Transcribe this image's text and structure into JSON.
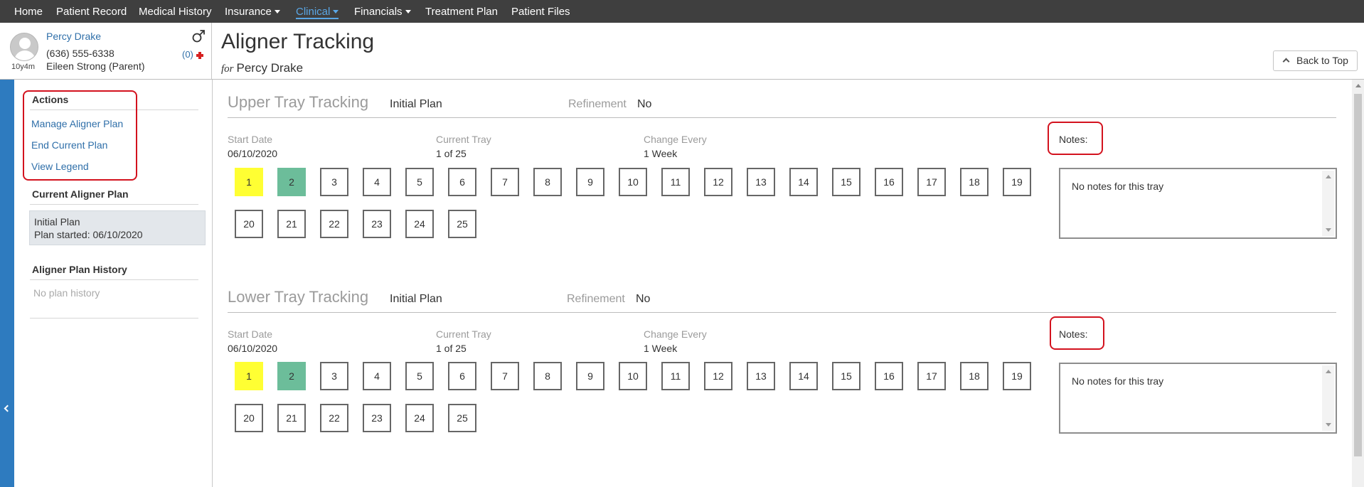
{
  "nav": {
    "items": [
      {
        "label": "Home"
      },
      {
        "label": "Patient Record"
      },
      {
        "label": "Medical History"
      },
      {
        "label": "Insurance"
      },
      {
        "label": "Clinical"
      },
      {
        "label": "Financials"
      },
      {
        "label": "Treatment Plan"
      },
      {
        "label": "Patient Files"
      }
    ],
    "active": "Clinical",
    "active_color": "#5aa7e6"
  },
  "patient": {
    "name": "Percy Drake",
    "phone": "(636) 555-6338",
    "parent": "Eileen Strong (Parent)",
    "age": "10y4m",
    "alerts": "(0)"
  },
  "page": {
    "title": "Aligner Tracking",
    "for_prefix": "for",
    "for_name": "Percy Drake",
    "back_to_top": "Back to Top"
  },
  "sidebar": {
    "actions_title": "Actions",
    "actions": [
      {
        "label": "Manage Aligner Plan"
      },
      {
        "label": "End Current Plan"
      },
      {
        "label": "View Legend"
      }
    ],
    "current_plan_title": "Current Aligner Plan",
    "current_plan_name": "Initial Plan",
    "current_plan_started": "Plan started: 06/10/2020",
    "history_title": "Aligner Plan History",
    "history_empty": "No plan history"
  },
  "upper": {
    "title": "Upper Tray Tracking",
    "plan": "Initial Plan",
    "refinement_label": "Refinement",
    "refinement_value": "No",
    "start_label": "Start Date",
    "start_value": "06/10/2020",
    "current_label": "Current Tray",
    "current_value": "1 of 25",
    "change_label": "Change Every",
    "change_value": "1 Week",
    "notes_label": "Notes:",
    "notes_text": "No notes for this tray"
  },
  "lower": {
    "title": "Lower Tray Tracking",
    "plan": "Initial Plan",
    "refinement_label": "Refinement",
    "refinement_value": "No",
    "start_label": "Start Date",
    "start_value": "06/10/2020",
    "current_label": "Current Tray",
    "current_value": "1 of 25",
    "change_label": "Change Every",
    "change_value": "1 Week",
    "notes_label": "Notes:",
    "notes_text": "No notes for this tray"
  },
  "trays": [
    "1",
    "2",
    "3",
    "4",
    "5",
    "6",
    "7",
    "8",
    "9",
    "10",
    "11",
    "12",
    "13",
    "14",
    "15",
    "16",
    "17",
    "18",
    "19",
    "20",
    "21",
    "22",
    "23",
    "24",
    "25"
  ],
  "tray_status_colors": {
    "current": "#ffff33",
    "completed": "#6cbd9a"
  },
  "highlight_color": "#d3121e",
  "sidebar_color": "#2e7bbf"
}
